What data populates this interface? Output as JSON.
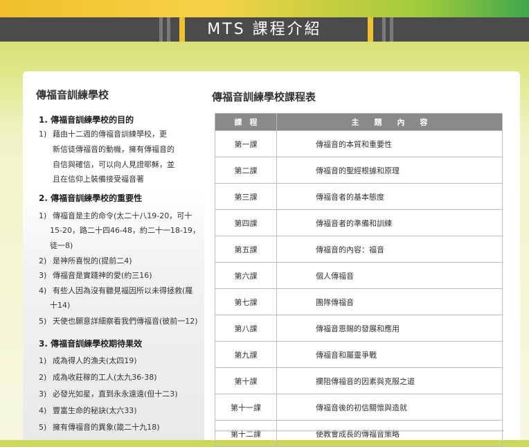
{
  "header": {
    "title": "MTS 課程介紹"
  },
  "left": {
    "section_title": "傳福音訓練學校",
    "part1": {
      "heading": "1. 傳福音訓練學校的目的",
      "item_num": "1)",
      "lines": [
        "藉由十二週的傳福音訓練學校，更",
        "新信徒傳福音的動機，擁有傳福音的",
        "自信與確信，可以向人見證耶穌，並",
        "且在信仰上裝備接受福音著"
      ]
    },
    "part2": {
      "heading": "2. 傳福音訓練學校的重要性",
      "items": [
        {
          "num": "1)",
          "lines": [
            "傳福音是主的命令(太二十八19-20，可十",
            "15-20，路二十四46-48，約二十一18-19，",
            "徒一8)"
          ]
        },
        {
          "num": "2)",
          "lines": [
            "是神所喜悅的(提前二4)"
          ]
        },
        {
          "num": "3)",
          "lines": [
            "傳福音是實踐神的愛(約三16)"
          ]
        },
        {
          "num": "4)",
          "lines": [
            "有些人因為沒有聽見福因所以未得拯救(羅",
            "十14)"
          ]
        },
        {
          "num": "5)",
          "lines": [
            "天使也願意詳細察看我們傳福音(彼前一12)"
          ]
        }
      ]
    },
    "part3": {
      "heading": "3. 傳福音訓練學校期待果效",
      "items": [
        {
          "num": "1)",
          "text": "成為得人的漁夫(太四19)"
        },
        {
          "num": "2)",
          "text": "成為收莊稼的工人(太九36-38)"
        },
        {
          "num": "3)",
          "text": "必發光如星，直到永永遠遠(但十二3)"
        },
        {
          "num": "4)",
          "text": "豐富生命的秘訣(太六33)"
        },
        {
          "num": "5)",
          "text": "擁有傳福音的異象(箴二十九18)"
        }
      ]
    }
  },
  "right": {
    "section_title": "傳福音訓練學校課程表",
    "table": {
      "headers": [
        "課　程",
        "主　　題　　內　　容"
      ],
      "rows": [
        [
          "第一課",
          "傳福音的本質和重要性"
        ],
        [
          "第二課",
          "傳福音的聖經根據和原理"
        ],
        [
          "第三課",
          "傳福音者的基本態度"
        ],
        [
          "第四課",
          "傳福音者的準備和訓練"
        ],
        [
          "第五課",
          "傳福音的內容：福音"
        ],
        [
          "第六課",
          "個人傳福音"
        ],
        [
          "第七課",
          "團隊傳福音"
        ],
        [
          "第八課",
          "傳福音恩賜的發展和應用"
        ],
        [
          "第九課",
          "傳福音和屬靈爭戰"
        ],
        [
          "第十課",
          "攔阻傳福音的因素與克服之道"
        ],
        [
          "第十一課",
          "傳福音後的初信關懷與造就"
        ],
        [
          "第十二課",
          "使教會成長的傳福音策略"
        ]
      ]
    }
  }
}
